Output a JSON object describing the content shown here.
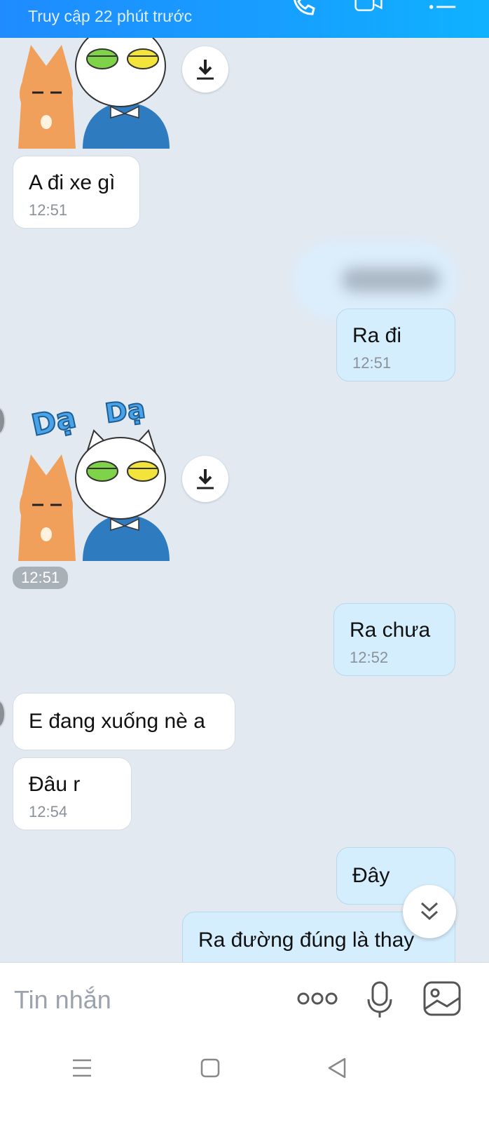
{
  "header": {
    "subtitle": "Truy cập 22 phút trước",
    "icons": [
      "phone-icon",
      "video-call-icon",
      "menu-list-icon"
    ]
  },
  "messages": {
    "m1": {
      "text": "A đi xe gì",
      "time": "12:51"
    },
    "m2": {
      "text": "Ra đi",
      "time": "12:51"
    },
    "sticker2": {
      "text1": "Dạ",
      "text2": "Dạ",
      "time": "12:51"
    },
    "m3": {
      "text": "Ra chưa",
      "time": "12:52"
    },
    "m4": {
      "text": "E đang xuống nè a"
    },
    "m5": {
      "text": "Đâu r",
      "time": "12:54"
    },
    "m6": {
      "text": "Đây"
    },
    "m7": {
      "text": "Ra đường đúng là thay"
    }
  },
  "input": {
    "placeholder": "Tin nhắn",
    "icons": [
      "more-options-icon",
      "microphone-icon",
      "image-icon"
    ]
  },
  "navbar": {
    "icons": [
      "recent-apps-icon",
      "home-icon",
      "back-icon"
    ]
  },
  "colors": {
    "header_blue": "#1f8bff",
    "chat_background": "#e2e9f1",
    "outgoing_bubble": "#d5eefe",
    "incoming_bubble": "#ffffff"
  }
}
